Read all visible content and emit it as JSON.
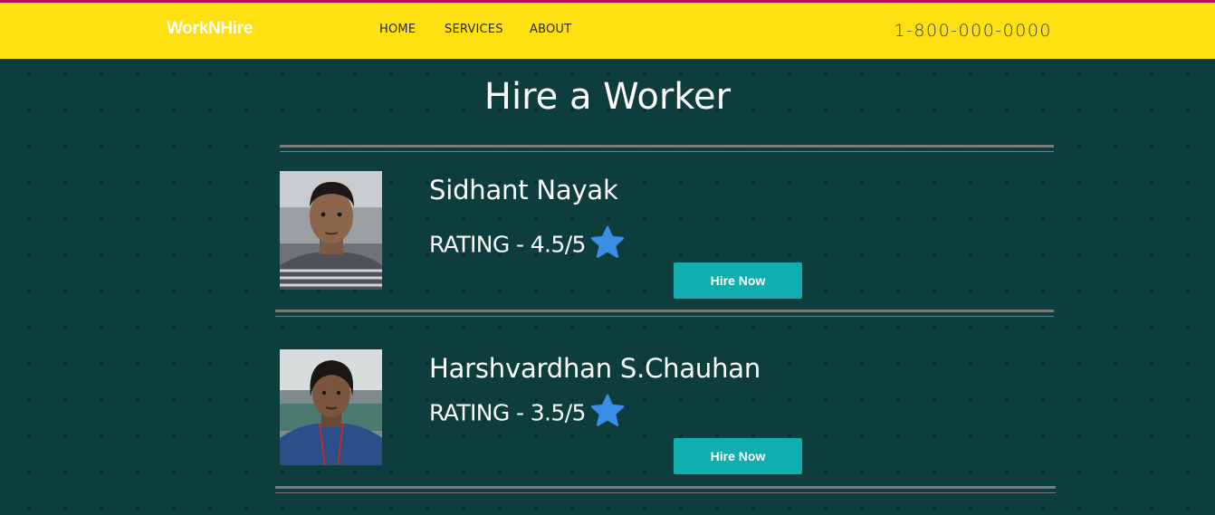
{
  "header": {
    "logo": "WorkNHire",
    "nav": [
      {
        "label": "HOME"
      },
      {
        "label": "SERVICES"
      },
      {
        "label": "ABOUT"
      }
    ],
    "phone": "1-800-000-0000"
  },
  "main": {
    "title": "Hire a Worker",
    "workers": [
      {
        "name": "Sidhant Nayak",
        "rating": "RATING - 4.5/5",
        "button_label": "Hire Now"
      },
      {
        "name": "Harshvardhan S.Chauhan",
        "rating": "RATING - 3.5/5",
        "button_label": "Hire Now"
      }
    ]
  },
  "colors": {
    "background": "#0d3d3d",
    "header": "#ffe011",
    "accent_top": "#b0135a",
    "button": "#10aeae",
    "star": "#3a8ee8"
  },
  "icons": [
    "star-icon"
  ]
}
